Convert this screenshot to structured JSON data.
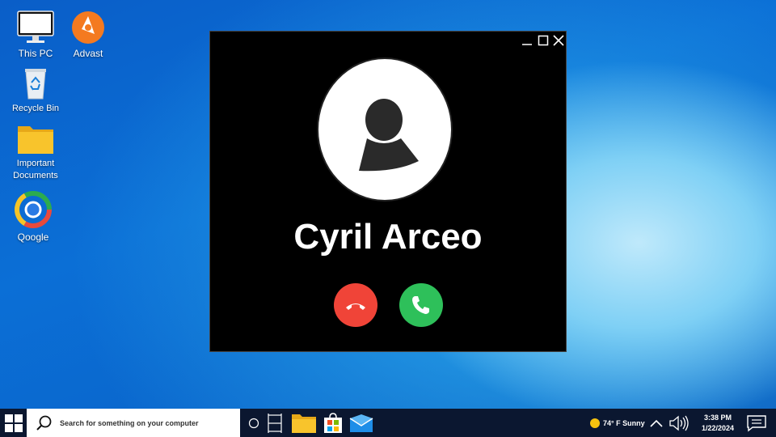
{
  "desktop": {
    "icons": [
      {
        "label": "This PC",
        "icon": "monitor-icon"
      },
      {
        "label": "Advast",
        "icon": "advast-icon"
      },
      {
        "label": "Recycle Bin",
        "icon": "recycle-bin-icon"
      },
      {
        "label": "Important Documents",
        "icon": "folder-icon"
      },
      {
        "label": "Qoogle",
        "icon": "browser-icon"
      }
    ]
  },
  "call": {
    "caller_name": "Cyril Arceo",
    "decline_color": "#f04438",
    "accept_color": "#2ec05a"
  },
  "taskbar": {
    "search_placeholder": "Search for something on your computer",
    "weather": "74° F Sunny",
    "time": "3:38 PM",
    "date": "1/22/2024",
    "background": "#0b1730"
  }
}
